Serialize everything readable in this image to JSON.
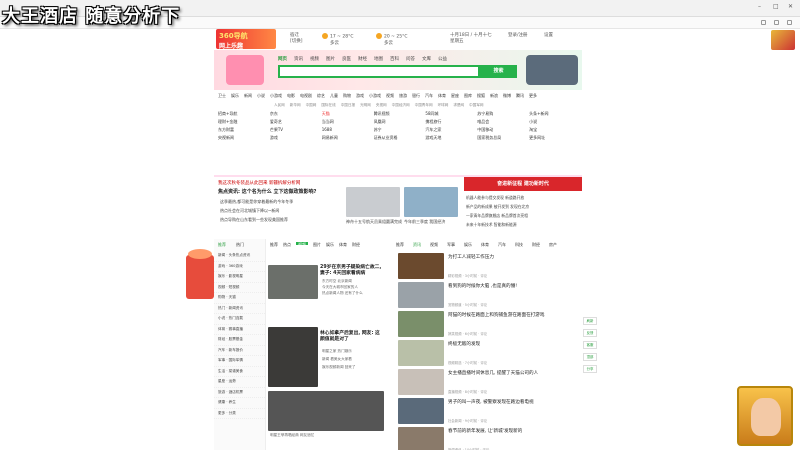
{
  "overlay": {
    "stream_title": "大王酒店 随意分析下"
  },
  "browser": {
    "window_controls": [
      "minimize-icon",
      "maximize-icon",
      "close-icon"
    ]
  },
  "header": {
    "logo_top": "360导航",
    "logo_sub": "网上乐趣",
    "city": "宿迁",
    "city_sub": "[切换]",
    "weather1": "17 ~ 28°C",
    "weather1_sub": "多云",
    "weather2": "20 ~ 25°C",
    "weather2_sub": "多云",
    "date": "十月18日 / 十月十七",
    "date_sub": "星期五",
    "login": "登录/注册",
    "settings": "设置"
  },
  "search": {
    "tabs": [
      "网页",
      "资讯",
      "视频",
      "图片",
      "良医",
      "财经",
      "地图",
      "百科",
      "问答",
      "文库",
      "公益"
    ],
    "active_tab": "网页",
    "button": "搜索",
    "placeholder": ""
  },
  "catnav": [
    "卫士",
    "娱乐",
    "新闻",
    "小说",
    "小游戏",
    "电影",
    "电视剧",
    "综艺",
    "儿童",
    "购物",
    "游戏",
    "小游戏",
    "视频",
    "旅游",
    "银行",
    "汽车",
    "体育",
    "星座",
    "图库",
    "搜狐",
    "新浪",
    "微博",
    "腾讯",
    "更多"
  ],
  "catnav2": [
    "人民网",
    "新华网",
    "中国网",
    "国际在线",
    "中国日报",
    "光明网",
    "央视网",
    "中国经济网",
    "中国青年网",
    "环球网",
    "求是网",
    "中国军网"
  ],
  "sites": [
    {
      "t": "招商+导航",
      "red": false
    },
    {
      "t": "京东",
      "red": false
    },
    {
      "t": "天猫",
      "red": true
    },
    {
      "t": "腾讯视频",
      "red": false
    },
    {
      "t": "58同城",
      "red": false
    },
    {
      "t": "苏宁易购",
      "red": false
    },
    {
      "t": "头条+新闻",
      "red": false
    },
    {
      "t": "理财+金融",
      "red": false
    },
    {
      "t": "爱奇艺",
      "red": false
    },
    {
      "t": "当当网",
      "red": false
    },
    {
      "t": "凤凰网",
      "red": false
    },
    {
      "t": "携程旅行",
      "red": false
    },
    {
      "t": "唯品会",
      "red": false
    },
    {
      "t": "小说",
      "red": false
    },
    {
      "t": "东方财富",
      "red": false
    },
    {
      "t": "芒果TV",
      "red": false
    },
    {
      "t": "1688",
      "red": false
    },
    {
      "t": "苏宁",
      "red": false
    },
    {
      "t": "汽车之家",
      "red": false
    },
    {
      "t": "中国移动",
      "red": false
    },
    {
      "t": "淘宝",
      "red": false
    },
    {
      "t": "央视新闻",
      "red": false
    },
    {
      "t": "游戏",
      "red": false
    },
    {
      "t": "网易新闻",
      "red": false
    },
    {
      "t": "证券从业资格",
      "red": false
    },
    {
      "t": "游戏天地",
      "red": false
    },
    {
      "t": "国家税务总局",
      "red": false
    },
    {
      "t": "更多网址",
      "red": false
    }
  ],
  "newsstrip": {
    "head": "我这次秋冬装品从此回来  新疆拆解分析网",
    "sub": "焦点资讯: 这个名为什么 立下这做政策影响?",
    "items": [
      "这季最热,都可能是你穿着最新的今年冬季",
      "热点社会在河北城镇下降以~新闻",
      "热点导购在山东看到一些发现美国推荐"
    ],
    "right_banner": "奋进新征程  建功新时代",
    "right_items": [
      "机器人能参与提交发现 新道路开放",
      "新产品的新成果 被开发到 发现在北京",
      "一家青年品牌旗舰店 新品牌首次亮相",
      "未来十年新技术 智能和新能源"
    ],
    "thumb1_cap": "神舟十五号航天员乘组圆满完成",
    "thumb2_cap": "今年前三季度 我国经济"
  },
  "leftcol": {
    "tabs": [
      "推荐",
      "热门"
    ],
    "active_tab": "推荐",
    "rows": [
      "新闻 · 头条热点资讯",
      "游戏 · 360游戏",
      "娱乐 · 影视明星",
      "视频 · 短视频",
      "购物 · 天猫",
      "热门 · 新闻资讯",
      "小说 · 热门连载",
      "体育 · 赛事直播",
      "财经 · 股票基金",
      "汽车 · 新车报价",
      "军事 · 国际军情",
      "生活 · 菜谱美食",
      "星座 · 运势",
      "旅游 · 酒店机票",
      "健康 · 养生",
      "更多 · 分类"
    ]
  },
  "midcol": {
    "tabs": [
      "推荐",
      "热点",
      "视频",
      "图片",
      "娱乐",
      "体育",
      "财经"
    ],
    "active_tab": "视频",
    "cards": [
      {
        "title": "29岁在京男子疑染病亡故二, 妻子: 4天回家看病病",
        "sub": [
          "东方时空 北京新闻",
          "今天在大城市回家的人",
          "热点新闻人物 还有了什么"
        ]
      },
      {
        "title": "林心如拿产后复出, 网友: 这颜值就是对了",
        "sub": [
          "明星之家 热门娱乐",
          "新闻 看美女大家看",
          "娱乐视频新闻 回来了"
        ]
      },
      {
        "title": "明星王菲再唱经典 网友追忆"
      }
    ]
  },
  "rightcol": {
    "tabs": [
      "推荐",
      "资讯",
      "视频",
      "军事",
      "娱乐",
      "体育",
      "汽车",
      "科技",
      "财经",
      "房产"
    ],
    "active_tab": "资讯",
    "feed": [
      {
        "t": "为打工人减轻工作压力",
        "m": "精彩视频 · 3小时前 · 评论"
      },
      {
        "t": "看到狗的时候你大脑 ,也是真的懵!",
        "m": "宠物频道 · 5小时前 · 评论"
      },
      {
        "t": "阿猫的时候在路面上和狗捕鱼游在路面在打游戏",
        "m": "搞笑视频 · 6小时前 · 评论"
      },
      {
        "t": "终极无敌的发现",
        "m": "视频精选 · 7小时前 · 评论"
      },
      {
        "t": "女主播直播时间休息几, 提醒了天猫公司的人",
        "m": "直播视频 · 8小时前 · 评论"
      },
      {
        "t": "男子的叫一声夜, 被警察发现在路边看电视",
        "m": "社会新闻 · 9小时前 · 评论"
      },
      {
        "t": "春节前的新年发展, 让'新城'发现新的",
        "m": "新闻资讯 · 10小时前 · 评论"
      }
    ]
  },
  "side_float": [
    "刷新",
    "反馈",
    "客服",
    "顶部",
    "分享"
  ],
  "colors": {
    "accent": "#26b24b",
    "brand_red": "#d9262b",
    "overlay_text": "#ffffff"
  }
}
